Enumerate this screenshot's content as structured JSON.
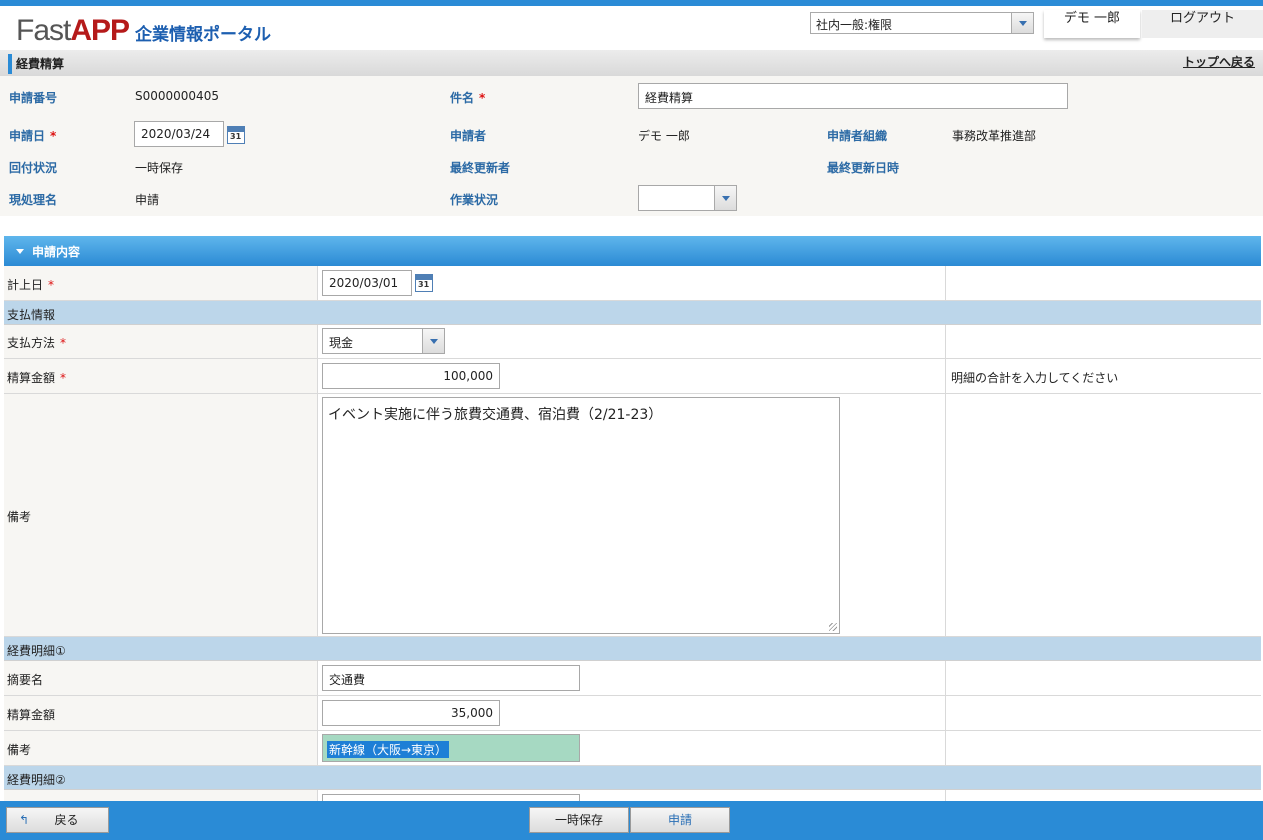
{
  "header": {
    "logo_fast": "Fast",
    "logo_app": "APP",
    "logo_portal": "企業情報ポータル",
    "role": "社内一般:権限",
    "user_name": "デモ 一郎",
    "logout": "ログアウト"
  },
  "titlebar": {
    "title": "経費精算",
    "back_link": "トップへ戻る"
  },
  "summary": {
    "app_no_label": "申請番号",
    "app_no": "S0000000405",
    "subject_label": "件名",
    "subject": "経費精算",
    "app_date_label": "申請日",
    "app_date": "2020/03/24",
    "applicant_label": "申請者",
    "applicant": "デモ 一郎",
    "org_label": "申請者組織",
    "org": "事務改革推進部",
    "route_status_label": "回付状況",
    "route_status": "一時保存",
    "last_updater_label": "最終更新者",
    "last_updated_label": "最終更新日時",
    "current_step_label": "現処理名",
    "current_step": "申請",
    "work_status_label": "作業状況",
    "required_mark": "*",
    "calendar_day": "31"
  },
  "section": {
    "title": "申請内容",
    "booking_date_label": "計上日",
    "booking_date": "2020/03/01",
    "payment_group": "支払情報",
    "payment_method_label": "支払方法",
    "payment_method": "現金",
    "amount_label": "精算金額",
    "amount": "100,000",
    "amount_hint": "明細の合計を入力してください",
    "remarks_label": "備考",
    "remarks": "イベント実施に伴う旅費交通費、宿泊費（2/21-23）",
    "detail1_group": "経費明細①",
    "detail1_summary_label": "摘要名",
    "detail1_summary": "交通費",
    "detail1_amount_label": "精算金額",
    "detail1_amount": "35,000",
    "detail1_remarks_label": "備考",
    "detail1_remarks": "新幹線（大阪→東京）",
    "detail2_group": "経費明細②"
  },
  "footer": {
    "back_icon": "↰",
    "back": "戻る",
    "save_draft": "一時保存",
    "submit": "申請"
  }
}
